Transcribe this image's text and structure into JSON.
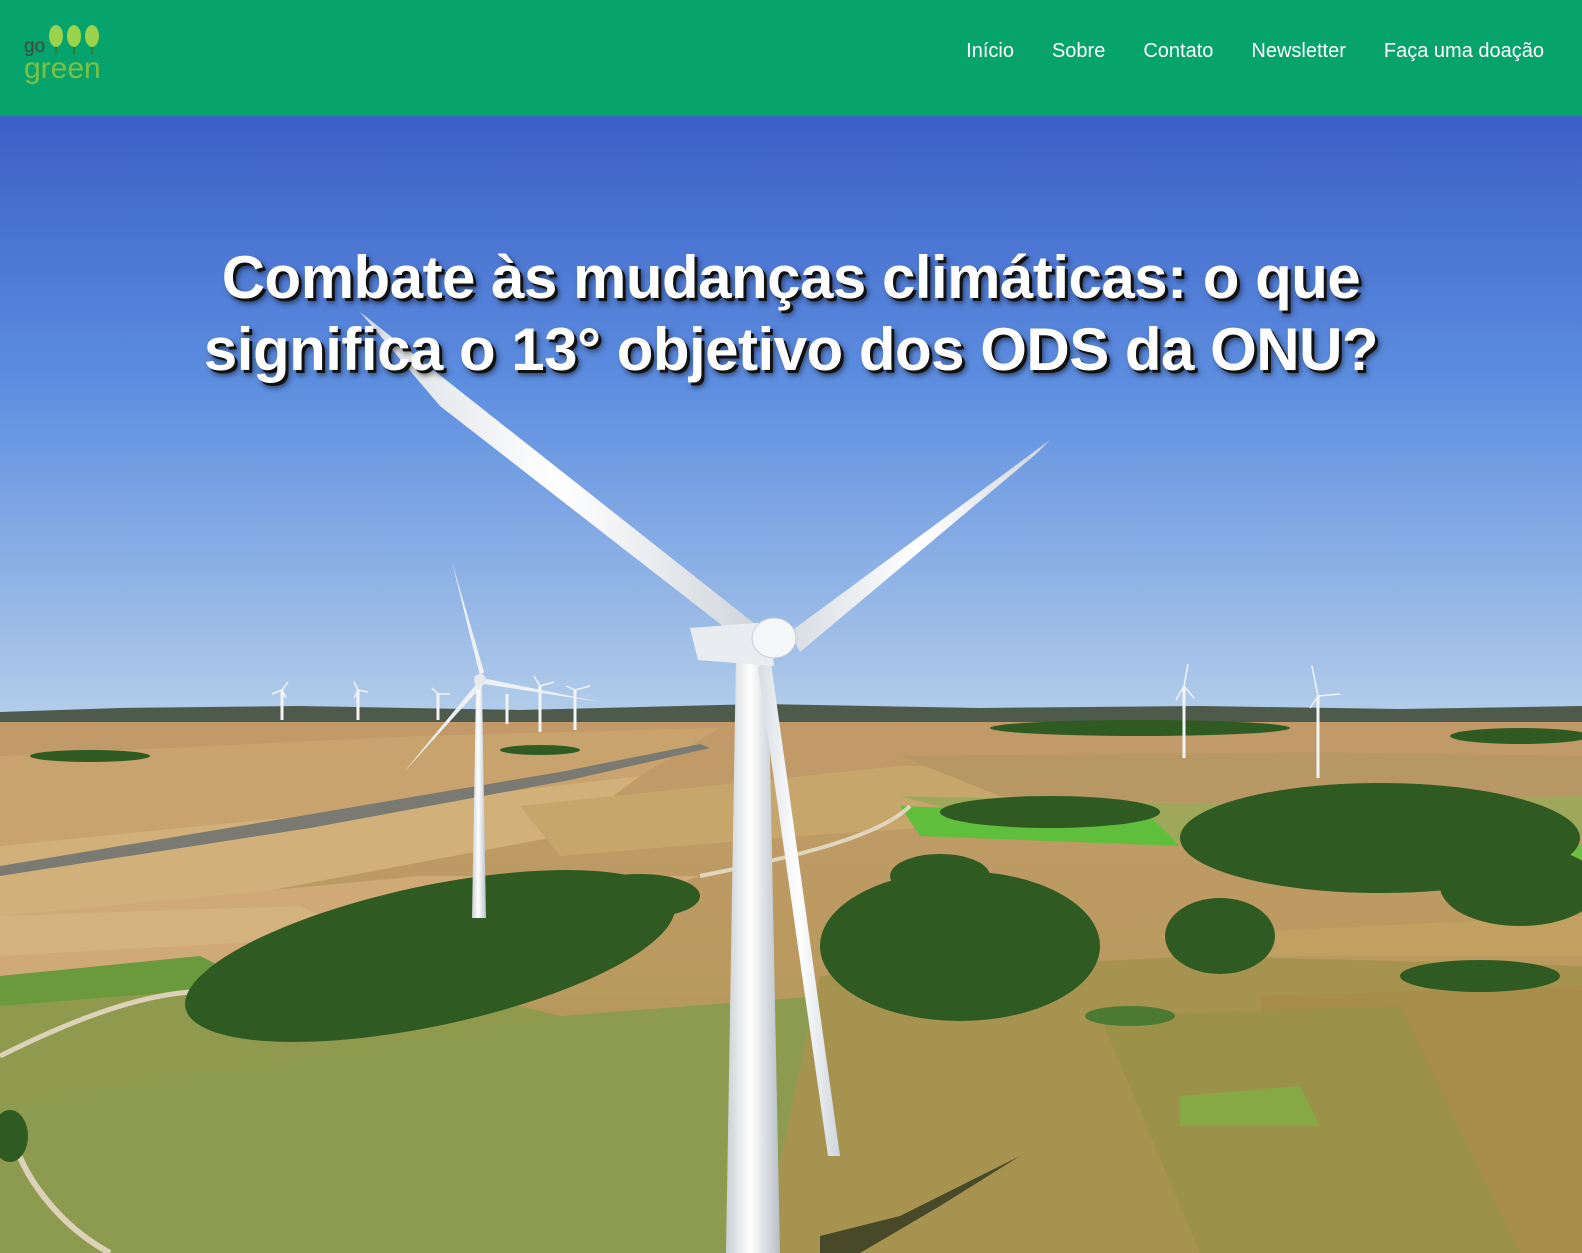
{
  "header": {
    "logo": {
      "go": "go",
      "green": "green"
    },
    "nav": [
      {
        "label": "Início"
      },
      {
        "label": "Sobre"
      },
      {
        "label": "Contato"
      },
      {
        "label": "Newsletter"
      },
      {
        "label": "Faça uma doação"
      }
    ]
  },
  "hero": {
    "title": "Combate às mudanças climáticas: o que significa o 13° objetivo dos ODS da ONU?",
    "image": "wind-turbines-fields-photo"
  },
  "colors": {
    "header_bg": "#06a36c",
    "nav_text": "#ffffff",
    "logo_green": "#7cc242",
    "sky_top": "#3d63c8",
    "sky_bottom": "#a8c6e8"
  }
}
